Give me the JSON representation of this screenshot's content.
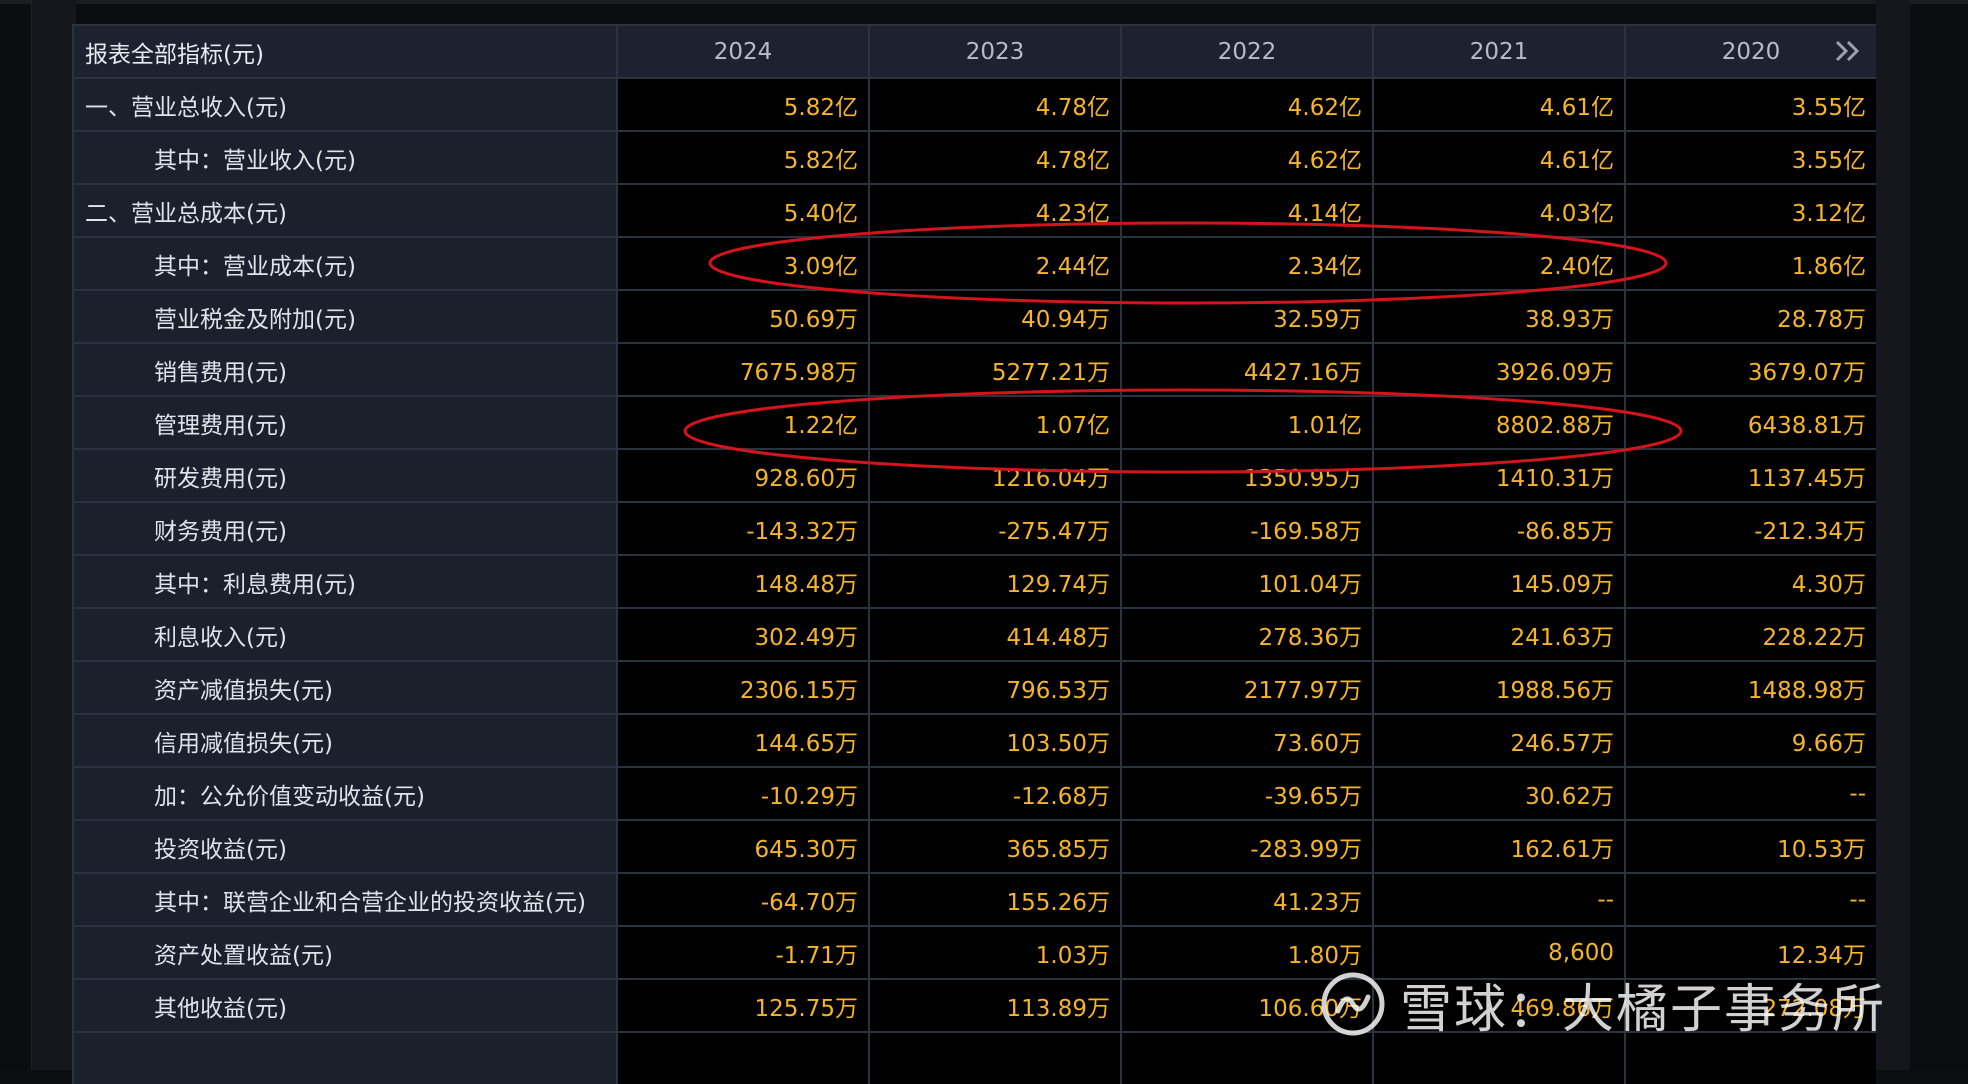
{
  "table": {
    "header_label": "报表全部指标(元)",
    "years": [
      "2024",
      "2023",
      "2022",
      "2021",
      "2020"
    ],
    "rows": [
      {
        "label": "一、营业总收入(元)",
        "level": 0,
        "values": [
          "5.82亿",
          "4.78亿",
          "4.62亿",
          "4.61亿",
          "3.55亿"
        ]
      },
      {
        "label": "其中：营业收入(元)",
        "level": 1,
        "values": [
          "5.82亿",
          "4.78亿",
          "4.62亿",
          "4.61亿",
          "3.55亿"
        ]
      },
      {
        "label": "二、营业总成本(元)",
        "level": 0,
        "values": [
          "5.40亿",
          "4.23亿",
          "4.14亿",
          "4.03亿",
          "3.12亿"
        ]
      },
      {
        "label": "其中：营业成本(元)",
        "level": 1,
        "values": [
          "3.09亿",
          "2.44亿",
          "2.34亿",
          "2.40亿",
          "1.86亿"
        ]
      },
      {
        "label": "营业税金及附加(元)",
        "level": 1,
        "values": [
          "50.69万",
          "40.94万",
          "32.59万",
          "38.93万",
          "28.78万"
        ]
      },
      {
        "label": "销售费用(元)",
        "level": 1,
        "values": [
          "7675.98万",
          "5277.21万",
          "4427.16万",
          "3926.09万",
          "3679.07万"
        ]
      },
      {
        "label": "管理费用(元)",
        "level": 1,
        "values": [
          "1.22亿",
          "1.07亿",
          "1.01亿",
          "8802.88万",
          "6438.81万"
        ]
      },
      {
        "label": "研发费用(元)",
        "level": 1,
        "values": [
          "928.60万",
          "1216.04万",
          "1350.95万",
          "1410.31万",
          "1137.45万"
        ]
      },
      {
        "label": "财务费用(元)",
        "level": 1,
        "values": [
          "-143.32万",
          "-275.47万",
          "-169.58万",
          "-86.85万",
          "-212.34万"
        ]
      },
      {
        "label": "其中：利息费用(元)",
        "level": 1,
        "values": [
          "148.48万",
          "129.74万",
          "101.04万",
          "145.09万",
          "4.30万"
        ]
      },
      {
        "label": "利息收入(元)",
        "level": 1,
        "values": [
          "302.49万",
          "414.48万",
          "278.36万",
          "241.63万",
          "228.22万"
        ]
      },
      {
        "label": "资产减值损失(元)",
        "level": 1,
        "values": [
          "2306.15万",
          "796.53万",
          "2177.97万",
          "1988.56万",
          "1488.98万"
        ]
      },
      {
        "label": "信用减值损失(元)",
        "level": 1,
        "values": [
          "144.65万",
          "103.50万",
          "73.60万",
          "246.57万",
          "9.66万"
        ]
      },
      {
        "label": "加：公允价值变动收益(元)",
        "level": 1,
        "values": [
          "-10.29万",
          "-12.68万",
          "-39.65万",
          "30.62万",
          "--"
        ]
      },
      {
        "label": "投资收益(元)",
        "level": 1,
        "values": [
          "645.30万",
          "365.85万",
          "-283.99万",
          "162.61万",
          "10.53万"
        ]
      },
      {
        "label": "其中：联营企业和合营企业的投资收益(元)",
        "level": 1,
        "values": [
          "-64.70万",
          "155.26万",
          "41.23万",
          "--",
          "--"
        ]
      },
      {
        "label": "资产处置收益(元)",
        "level": 1,
        "values": [
          "-1.71万",
          "1.03万",
          "1.80万",
          "8,600",
          "12.34万"
        ]
      },
      {
        "label": "其他收益(元)",
        "level": 1,
        "values": [
          "125.75万",
          "113.89万",
          "106.60万",
          "469.86万",
          "272.08万"
        ]
      },
      {
        "label": "",
        "level": 0,
        "values": [
          "",
          "",
          "",
          "",
          ""
        ]
      }
    ]
  },
  "watermark": {
    "text": "雪球：大橘子事务所"
  },
  "colors": {
    "value_text": "#f6b42c",
    "highlight_ellipse": "#d4141c"
  },
  "icons": {
    "more": "double-chevron-right-icon",
    "watermark_logo": "snowball-logo-icon"
  }
}
